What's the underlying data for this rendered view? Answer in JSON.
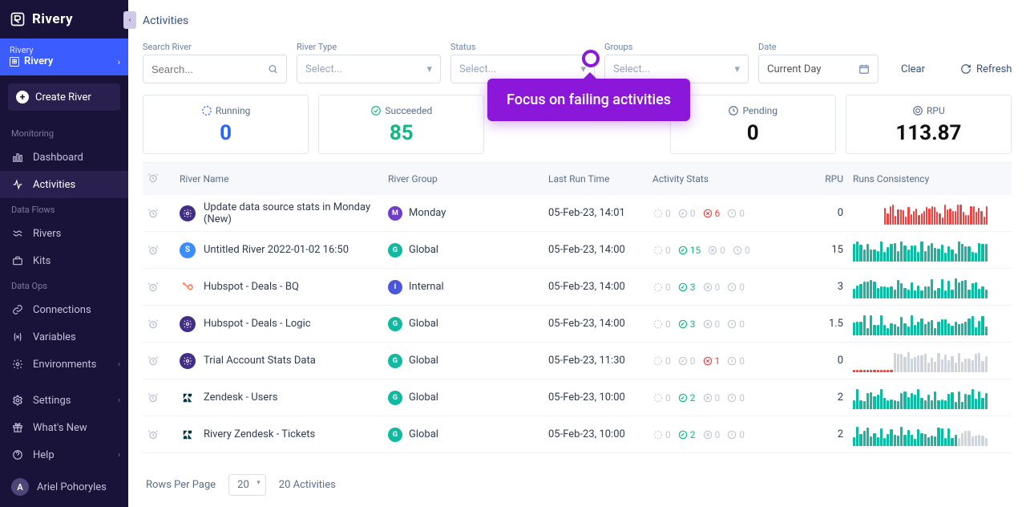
{
  "brand": "Rivery",
  "breadcrumb": {
    "parent": "Rivery",
    "current": "Rivery"
  },
  "create_label": "Create River",
  "nav": {
    "monitoring_heading": "Monitoring",
    "dashboard": "Dashboard",
    "activities": "Activities",
    "dataflows_heading": "Data Flows",
    "rivers": "Rivers",
    "kits": "Kits",
    "dataops_heading": "Data Ops",
    "connections": "Connections",
    "variables": "Variables",
    "environments": "Environments",
    "settings": "Settings",
    "whatsnew": "What's New",
    "help": "Help"
  },
  "user": {
    "initial": "A",
    "name": "Ariel Pohoryles"
  },
  "page_title": "Activities",
  "filters": {
    "search_label": "Search River",
    "search_placeholder": "Search...",
    "type_label": "River Type",
    "status_label": "Status",
    "groups_label": "Groups",
    "select_placeholder": "Select...",
    "date_label": "Date",
    "date_value": "Current Day",
    "clear": "Clear",
    "refresh": "Refresh"
  },
  "stats": {
    "running_label": "Running",
    "running_value": "0",
    "succeeded_label": "Succeeded",
    "succeeded_value": "85",
    "pending_label": "Pending",
    "pending_value": "0",
    "rpu_label": "RPU",
    "rpu_value": "113.87"
  },
  "callout": "Focus on failing activities",
  "columns": {
    "name": "River Name",
    "group": "River Group",
    "last": "Last Run Time",
    "act": "Activity Stats",
    "rpu": "RPU",
    "runs": "Runs Consistency"
  },
  "rows": [
    {
      "icon": "gear",
      "name": "Update data source stats in Monday (New)",
      "groupIcon": "purple",
      "group": "Monday",
      "last": "05-Feb-23, 14:01",
      "running": "0",
      "ok": "0",
      "fail": "6",
      "pend": "0",
      "rpu": "0",
      "spark": "red"
    },
    {
      "icon": "s",
      "name": "Untitled River 2022-01-02 16:50",
      "groupIcon": "teal",
      "group": "Global",
      "last": "05-Feb-23, 14:00",
      "running": "0",
      "ok": "15",
      "fail": "0",
      "pend": "0",
      "rpu": "15",
      "spark": "green"
    },
    {
      "icon": "hubspot",
      "name": "Hubspot - Deals - BQ",
      "groupIcon": "blue",
      "group": "Internal",
      "last": "05-Feb-23, 14:00",
      "running": "0",
      "ok": "3",
      "fail": "0",
      "pend": "0",
      "rpu": "3",
      "spark": "green"
    },
    {
      "icon": "gear",
      "name": "Hubspot - Deals - Logic",
      "groupIcon": "teal",
      "group": "Global",
      "last": "05-Feb-23, 14:00",
      "running": "0",
      "ok": "3",
      "fail": "0",
      "pend": "0",
      "rpu": "1.5",
      "spark": "green"
    },
    {
      "icon": "gear",
      "name": "Trial Account Stats Data",
      "groupIcon": "teal",
      "group": "Global",
      "last": "05-Feb-23, 11:30",
      "running": "0",
      "ok": "0",
      "fail": "1",
      "pend": "0",
      "rpu": "0",
      "spark": "mixed"
    },
    {
      "icon": "zen",
      "name": "Zendesk - Users",
      "groupIcon": "teal",
      "group": "Global",
      "last": "05-Feb-23, 10:00",
      "running": "0",
      "ok": "2",
      "fail": "0",
      "pend": "0",
      "rpu": "2",
      "spark": "green"
    },
    {
      "icon": "zen",
      "name": "Rivery Zendesk - Tickets",
      "groupIcon": "teal",
      "group": "Global",
      "last": "05-Feb-23, 10:00",
      "running": "0",
      "ok": "2",
      "fail": "0",
      "pend": "0",
      "rpu": "2",
      "spark": "green2"
    }
  ],
  "footer": {
    "rpp_label": "Rows Per Page",
    "rpp_value": "20",
    "count": "20 Activities"
  }
}
